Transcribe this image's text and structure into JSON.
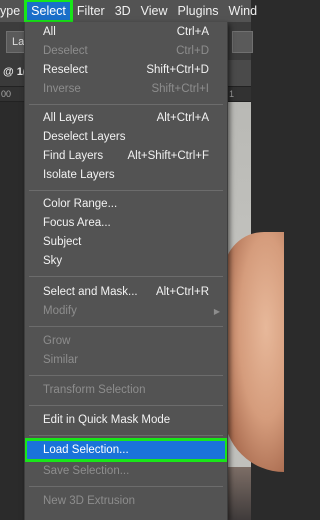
{
  "menubar": {
    "items": [
      {
        "label": "ype"
      },
      {
        "label": "Select"
      },
      {
        "label": "Filter"
      },
      {
        "label": "3D"
      },
      {
        "label": "View"
      },
      {
        "label": "Plugins"
      },
      {
        "label": "Wind"
      }
    ]
  },
  "optionsbar": {
    "left_field": "La"
  },
  "doctab": {
    "label": "@ 1("
  },
  "ruler": {
    "left_number": "00",
    "right_number": "1"
  },
  "menu": {
    "items": [
      {
        "label": "All",
        "shortcut": "Ctrl+A"
      },
      {
        "label": "Deselect",
        "shortcut": "Ctrl+D"
      },
      {
        "label": "Reselect",
        "shortcut": "Shift+Ctrl+D"
      },
      {
        "label": "Inverse",
        "shortcut": "Shift+Ctrl+I"
      },
      {
        "label": "All Layers",
        "shortcut": "Alt+Ctrl+A"
      },
      {
        "label": "Deselect Layers",
        "shortcut": ""
      },
      {
        "label": "Find Layers",
        "shortcut": "Alt+Shift+Ctrl+F"
      },
      {
        "label": "Isolate Layers",
        "shortcut": ""
      },
      {
        "label": "Color Range...",
        "shortcut": ""
      },
      {
        "label": "Focus Area...",
        "shortcut": ""
      },
      {
        "label": "Subject",
        "shortcut": ""
      },
      {
        "label": "Sky",
        "shortcut": ""
      },
      {
        "label": "Select and Mask...",
        "shortcut": "Alt+Ctrl+R"
      },
      {
        "label": "Modify",
        "shortcut": ""
      },
      {
        "label": "Grow",
        "shortcut": ""
      },
      {
        "label": "Similar",
        "shortcut": ""
      },
      {
        "label": "Transform Selection",
        "shortcut": ""
      },
      {
        "label": "Edit in Quick Mask Mode",
        "shortcut": ""
      },
      {
        "label": "Load Selection...",
        "shortcut": ""
      },
      {
        "label": "Save Selection...",
        "shortcut": ""
      },
      {
        "label": "New 3D Extrusion",
        "shortcut": ""
      }
    ]
  }
}
